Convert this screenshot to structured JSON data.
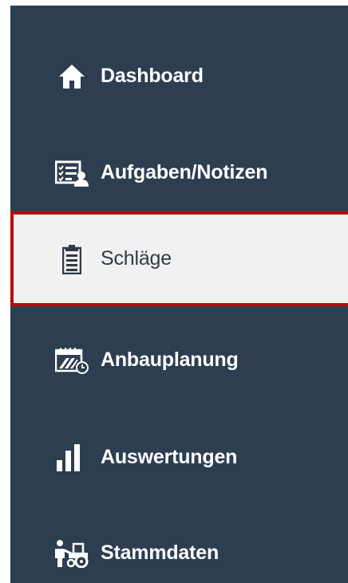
{
  "sidebar": {
    "items": [
      {
        "label": "Dashboard",
        "icon": "home-icon"
      },
      {
        "label": "Aufgaben/Notizen",
        "icon": "tasks-notes-icon"
      },
      {
        "label": "Schläge",
        "icon": "clipboard-icon",
        "active": true
      },
      {
        "label": "Anbauplanung",
        "icon": "calendar-field-icon"
      },
      {
        "label": "Auswertungen",
        "icon": "bar-chart-icon"
      },
      {
        "label": "Stammdaten",
        "icon": "farmer-tractor-icon"
      }
    ],
    "colors": {
      "background": "#2c3e50",
      "active_background": "#f1f1f1",
      "active_border": "#b80c0c",
      "text": "#ffffff",
      "active_text": "#333b45"
    }
  }
}
